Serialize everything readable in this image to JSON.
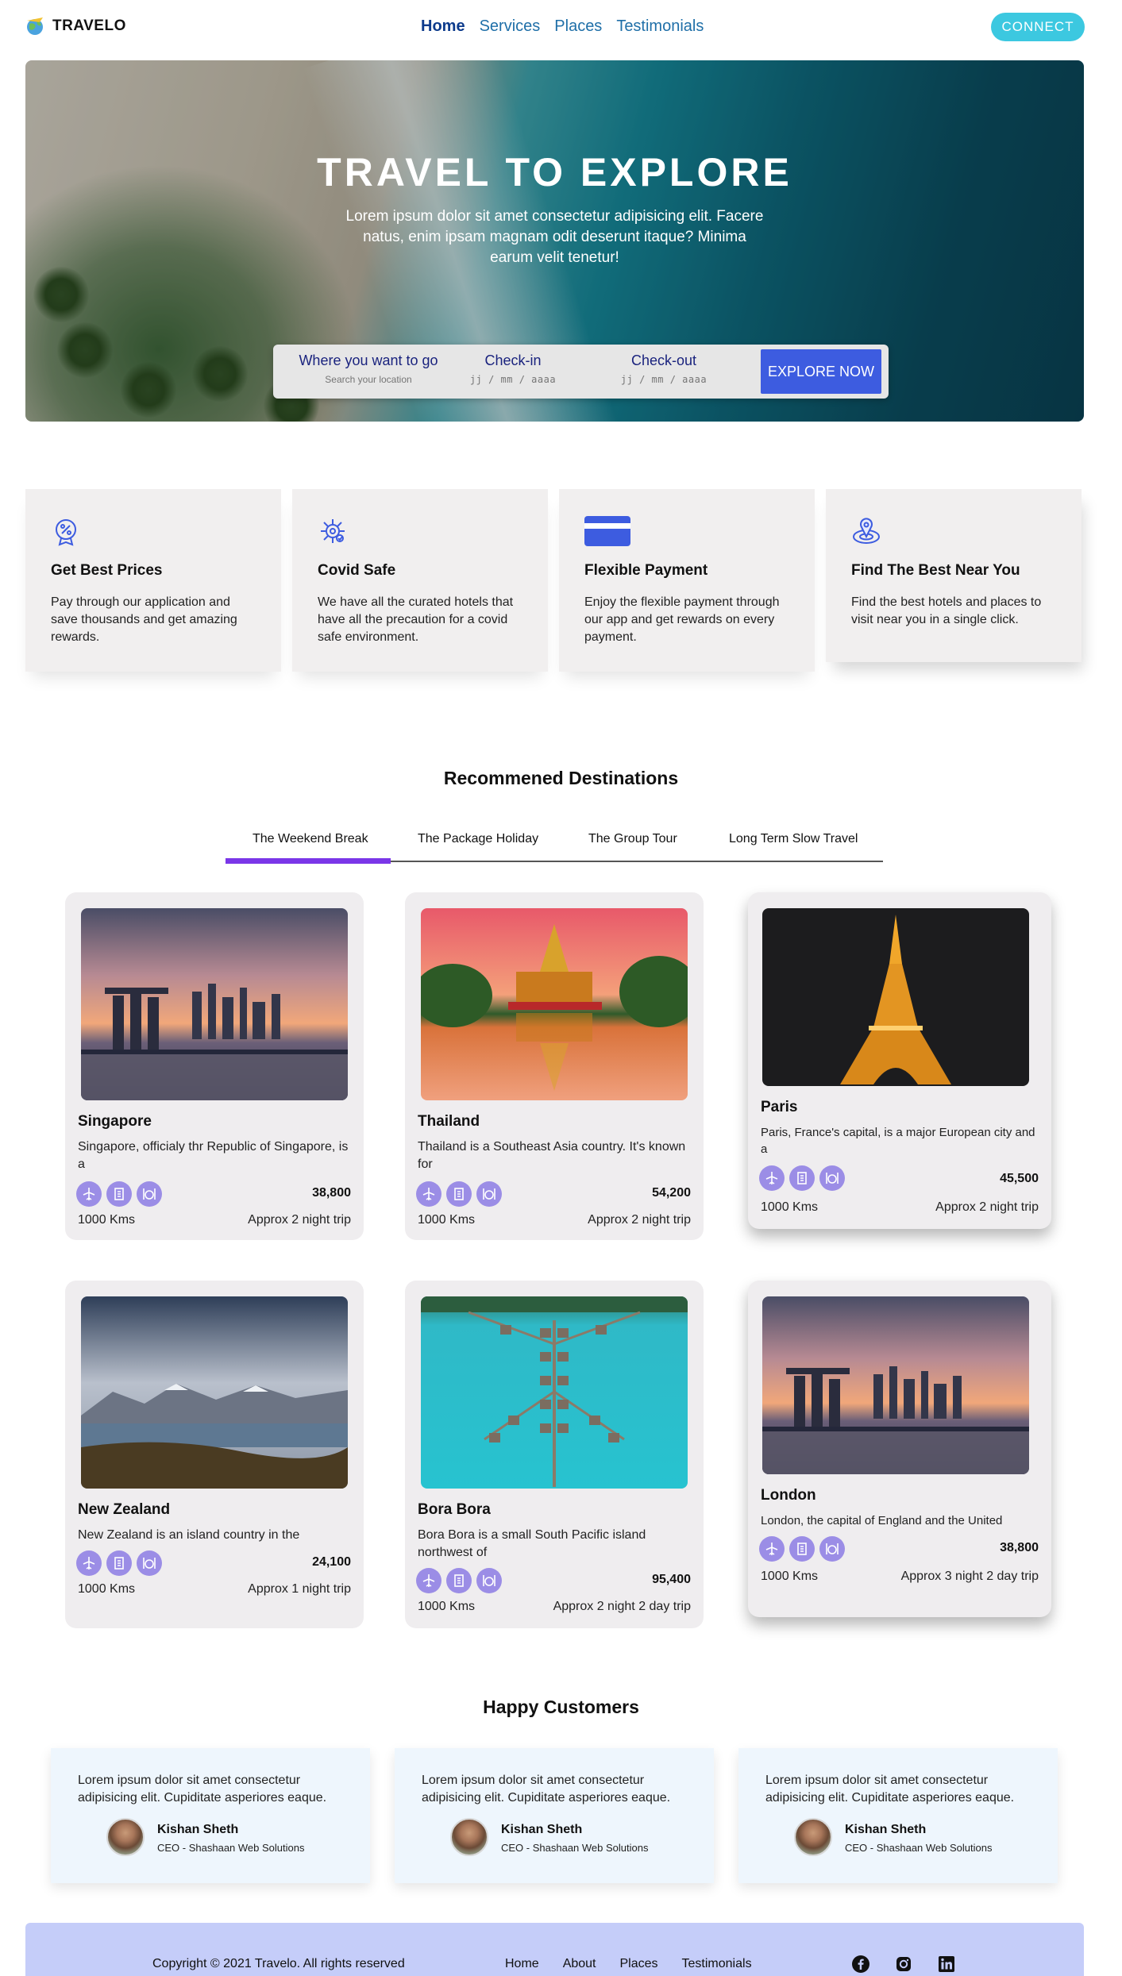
{
  "nav": {
    "brand": "TRAVELO",
    "links": [
      "Home",
      "Services",
      "Places",
      "Testimonials"
    ],
    "active_link": "Home",
    "connect": "CONNECT"
  },
  "hero": {
    "title": "TRAVEL TO EXPLORE",
    "subtitle": "Lorem ipsum dolor sit amet consectetur adipisicing elit. Facere natus, enim ipsam magnam odit deserunt itaque? Minima earum velit tenetur!",
    "search": {
      "where_label": "Where you want to go",
      "where_placeholder": "Search your location",
      "checkin_label": "Check-in",
      "checkin_placeholder": "jj / mm / aaaa",
      "checkout_label": "Check-out",
      "checkout_placeholder": "jj / mm / aaaa",
      "button": "EXPLORE NOW"
    }
  },
  "features": [
    {
      "icon": "discount-badge-icon",
      "title": "Get Best Prices",
      "text": "Pay through our application and save thousands and get amazing rewards."
    },
    {
      "icon": "virus-icon",
      "title": "Covid Safe",
      "text": "We have all the curated hotels that have all the precaution for a covid safe environment."
    },
    {
      "icon": "credit-card-icon",
      "title": "Flexible Payment",
      "text": "Enjoy the flexible payment through our app and get rewards on every payment."
    },
    {
      "icon": "location-pin-icon",
      "title": "Find The Best Near You",
      "text": "Find the best hotels and places to visit near you in a single click."
    }
  ],
  "destinations": {
    "title": "Recommened Destinations",
    "tabs": [
      "The Weekend Break",
      "The Package Holiday",
      "The Group Tour",
      "Long Term Slow Travel"
    ],
    "active_tab": "The Weekend Break",
    "card_icons": [
      "plane-icon",
      "hotel-icon",
      "food-icon"
    ],
    "cards": [
      {
        "name": "Singapore",
        "desc": "Singapore, officialy thr Republic of Singapore, is a",
        "price": "38,800",
        "distance": "1000 Kms",
        "trip": "Approx 2 night trip"
      },
      {
        "name": "Thailand",
        "desc": "Thailand is a Southeast Asia country. It's known for",
        "price": "54,200",
        "distance": "1000 Kms",
        "trip": "Approx 2 night trip"
      },
      {
        "name": "Paris",
        "desc": "Paris, France's capital, is a major European city and a",
        "price": "45,500",
        "distance": "1000 Kms",
        "trip": "Approx 2 night trip"
      },
      {
        "name": "New Zealand",
        "desc": "New Zealand is an island country in the",
        "price": "24,100",
        "distance": "1000 Kms",
        "trip": "Approx 1 night trip"
      },
      {
        "name": "Bora Bora",
        "desc": "Bora Bora is a small South Pacific island northwest of",
        "price": "95,400",
        "distance": "1000 Kms",
        "trip": "Approx 2 night 2 day trip"
      },
      {
        "name": "London",
        "desc": "London, the capital of England and the United",
        "price": "38,800",
        "distance": "1000 Kms",
        "trip": "Approx 3 night 2 day trip"
      }
    ]
  },
  "testimonials": {
    "title": "Happy Customers",
    "items": [
      {
        "quote": "Lorem ipsum dolor sit amet consectetur adipisicing elit. Cupiditate asperiores eaque.",
        "name": "Kishan Sheth",
        "role": "CEO - Shashaan Web Solutions"
      },
      {
        "quote": "Lorem ipsum dolor sit amet consectetur adipisicing elit. Cupiditate asperiores eaque.",
        "name": "Kishan Sheth",
        "role": "CEO - Shashaan Web Solutions"
      },
      {
        "quote": "Lorem ipsum dolor sit amet consectetur adipisicing elit. Cupiditate asperiores eaque.",
        "name": "Kishan Sheth",
        "role": "CEO - Shashaan Web Solutions"
      }
    ]
  },
  "footer": {
    "copyright": "Copyright © 2021 Travelo. All rights reserved",
    "links": [
      "Home",
      "About",
      "Places",
      "Testimonials"
    ],
    "socials": [
      "facebook-icon",
      "instagram-icon",
      "linkedin-icon"
    ]
  },
  "colors": {
    "brand_blue": "#3d5ce0",
    "connect_cyan": "#3cc8e0",
    "tab_indicator": "#7a36e8",
    "footer_bg": "#c5cdf9",
    "card_icon": "#9b8de6"
  }
}
